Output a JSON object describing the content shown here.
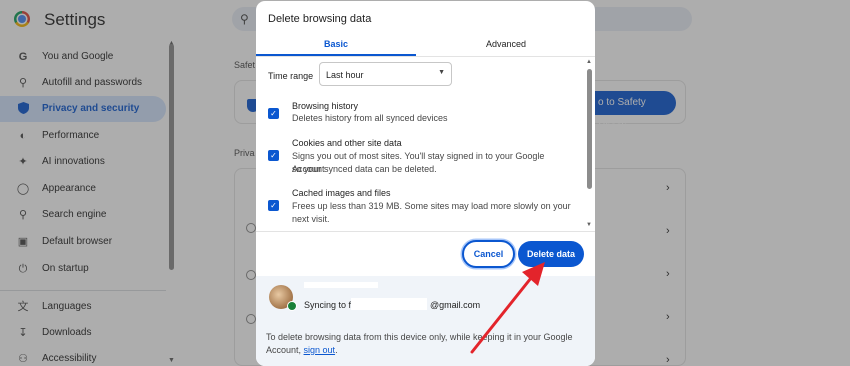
{
  "header": {
    "title": "Settings"
  },
  "sidebar": {
    "items": [
      {
        "label": "You and Google",
        "icon": "google-g-icon"
      },
      {
        "label": "Autofill and passwords",
        "icon": "key-icon"
      },
      {
        "label": "Privacy and security",
        "icon": "shield-icon",
        "active": true
      },
      {
        "label": "Performance",
        "icon": "speedometer-icon"
      },
      {
        "label": "AI innovations",
        "icon": "sparkle-icon"
      },
      {
        "label": "Appearance",
        "icon": "palette-icon"
      },
      {
        "label": "Search engine",
        "icon": "search-icon"
      },
      {
        "label": "Default browser",
        "icon": "browser-window-icon"
      },
      {
        "label": "On startup",
        "icon": "power-icon"
      },
      {
        "label": "Languages",
        "icon": "translate-icon"
      },
      {
        "label": "Downloads",
        "icon": "download-icon"
      },
      {
        "label": "Accessibility",
        "icon": "accessibility-icon"
      }
    ]
  },
  "main": {
    "safety_section_label": "Safet",
    "safety_button_label": "o to Safety Check",
    "privacy_section_label": "Priva"
  },
  "dialog": {
    "title": "Delete browsing data",
    "tabs": [
      {
        "label": "Basic",
        "active": true
      },
      {
        "label": "Advanced"
      }
    ],
    "time_range": {
      "label": "Time range",
      "value": "Last hour"
    },
    "options": [
      {
        "title": "Browsing history",
        "desc_lines": [
          "Deletes history from all synced devices"
        ],
        "checked": true
      },
      {
        "title": "Cookies and other site data",
        "desc_lines": [
          "Signs you out of most sites. You'll stay signed in to your Google Account",
          "so your synced data can be deleted."
        ],
        "checked": true
      },
      {
        "title": "Cached images and files",
        "desc_lines": [
          "Frees up less than 319 MB. Some sites may load more slowly on your",
          "next visit."
        ],
        "checked": true
      }
    ],
    "cancel_label": "Cancel",
    "delete_label": "Delete data",
    "account": {
      "sync_prefix": "Syncing to f",
      "email_suffix": "@gmail.com"
    },
    "footer_text_before": "To delete browsing data from this device only, while keeping it in your Google Account, ",
    "footer_link": "sign out",
    "footer_text_after": "."
  },
  "colors": {
    "accent": "#0b57d0",
    "annotation_arrow": "#e3242b",
    "overlay": "rgba(60,60,60,0.42)"
  }
}
